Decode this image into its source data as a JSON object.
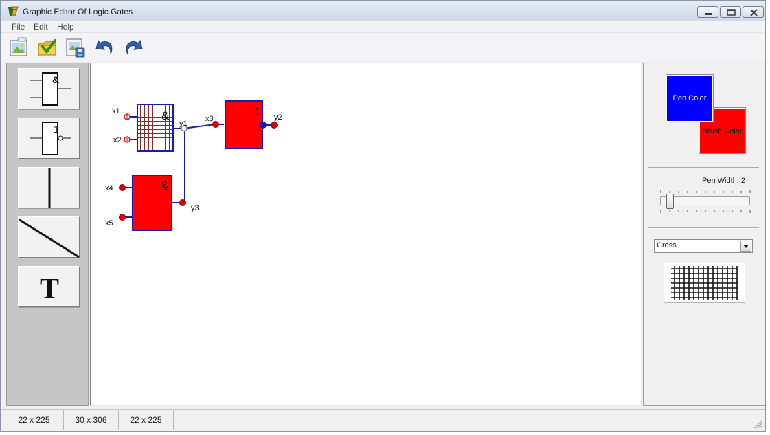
{
  "window": {
    "title": "Graphic Editor Of Logic Gates",
    "controls": {
      "minimize": "minimize",
      "maximize": "maximize",
      "close": "close"
    }
  },
  "menu": {
    "items": [
      "File",
      "Edit",
      "Help"
    ]
  },
  "toolbar": {
    "buttons": [
      {
        "name": "new-document",
        "icon": "new-image-icon"
      },
      {
        "name": "open-document",
        "icon": "open-folder-check-icon"
      },
      {
        "name": "save-document",
        "icon": "save-image-icon"
      },
      {
        "name": "undo",
        "icon": "undo-arrow-icon"
      },
      {
        "name": "redo",
        "icon": "redo-arrow-icon"
      }
    ]
  },
  "tools": [
    {
      "name": "and-gate-tool",
      "symbol": "&"
    },
    {
      "name": "or-not-gate-tool",
      "symbol": "1"
    },
    {
      "name": "vertical-line-tool",
      "symbol": ""
    },
    {
      "name": "diagonal-line-tool",
      "symbol": ""
    },
    {
      "name": "text-tool",
      "symbol": "T"
    }
  ],
  "canvas": {
    "gates": [
      {
        "name": "and-gate-1",
        "symbol": "&",
        "fill": "cross-hatch"
      },
      {
        "name": "or-gate-1",
        "symbol": "1",
        "fill": "#ff0000"
      },
      {
        "name": "and-gate-2",
        "symbol": "&",
        "fill": "#ff0000"
      }
    ],
    "labels": {
      "x1": "x1",
      "x2": "x2",
      "x3": "x3",
      "x4": "x4",
      "x5": "x5",
      "y1": "y1",
      "y2": "y2",
      "y3": "y3"
    }
  },
  "properties": {
    "pen_color_label": "Pen Color",
    "brush_color_label": "Brush Color",
    "pen_color": "#0000ff",
    "brush_color": "#ff0000",
    "pen_width_label": "Pen Width: 2",
    "pen_width": 2,
    "brush_style": "Cross"
  },
  "status": {
    "panes": [
      "22 x 225",
      "30 x 306",
      "22 x 225"
    ]
  }
}
